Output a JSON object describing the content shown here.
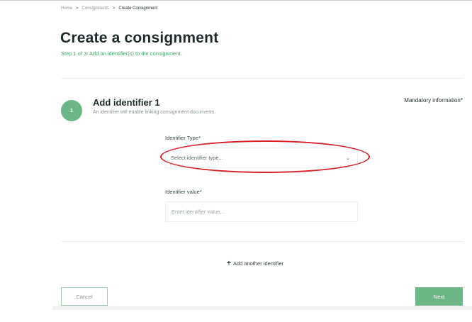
{
  "breadcrumb": {
    "items": [
      "Home",
      "Consignments",
      "Create Consignment"
    ],
    "separator": ">"
  },
  "page": {
    "title": "Create a consignment",
    "step_text": "Step 1 of 3: Add an identifier(s) to the consignment."
  },
  "section": {
    "step_number": "1",
    "title": "Add identifier 1",
    "subtitle": "An identifier will enable linking consignment documents.",
    "mandatory_note": "Mandatory information*"
  },
  "form": {
    "identifier_type_label": "Identifier Type*",
    "identifier_type_placeholder": "Select identifier type...",
    "identifier_value_label": "Identifier value*",
    "identifier_value_placeholder": "Enter identifier value..."
  },
  "actions": {
    "add_another": "Add another identifier",
    "cancel": "Cancel",
    "next": "Next"
  },
  "colors": {
    "accent_green": "#6cb688",
    "step_text_green": "#3fa36a",
    "annotation_red": "#d8202a"
  },
  "icons": {
    "select_chevron": "chevron-down-icon",
    "add": "plus-icon"
  }
}
